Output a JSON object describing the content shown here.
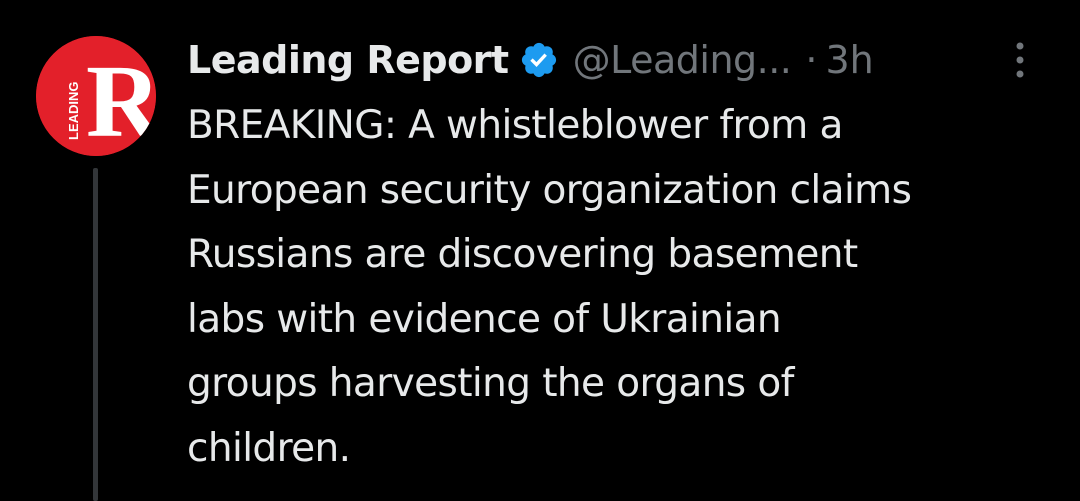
{
  "tweet": {
    "author_name": "Leading Report",
    "handle": "@Leading...",
    "separator": "·",
    "timestamp": "3h",
    "avatar": {
      "icon": "leading-report-logo",
      "letter": "R",
      "text": "LEADING",
      "color": "#e3202a"
    },
    "verified_icon": "verified-badge-icon",
    "verified_color": "#1d9bf0",
    "more_icon": "more-options-icon",
    "text_lines": [
      "BREAKING: A whistleblower from a",
      "European security organization claims",
      "Russians are discovering basement",
      "labs with evidence of Ukrainian",
      "groups harvesting the organs of",
      "children."
    ]
  },
  "colors": {
    "background": "#000000",
    "primary_text": "#e7e9ea",
    "secondary_text": "#71767b",
    "thread_line": "#333639"
  }
}
